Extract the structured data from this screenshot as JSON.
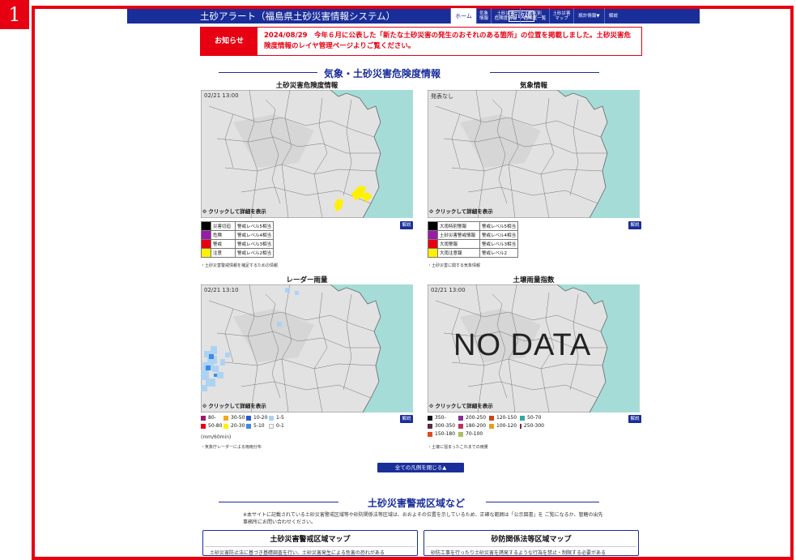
{
  "step_number": "1",
  "header": {
    "title": "土砂アラート（福島県土砂災害情報システム）",
    "badge": "行政版",
    "nav": [
      {
        "label": "ホーム",
        "active": true
      },
      {
        "label": "気象\n情報"
      },
      {
        "label": "土砂災害\n危険度情報"
      },
      {
        "label": "地区別\n危険度一覧"
      },
      {
        "label": "土砂災害\nマップ"
      },
      {
        "label": "統計情報▼"
      },
      {
        "label": "解説"
      }
    ]
  },
  "notice": {
    "label": "お知らせ",
    "text": "2024/08/29　今年６月に公表した「新たな土砂災害の発生のおそれのある箇所」の位置を掲載しました。土砂災害危険度情報のレイヤ管理ページよりご覧ください。"
  },
  "section1_title": "気象・土砂災害危険度情報",
  "panels": {
    "risk": {
      "title": "土砂災害危険度情報",
      "timestamp": "02/21 13:00",
      "hint": "クリックして詳細を表示",
      "help": "解説",
      "legend": [
        {
          "color": "#000000",
          "label": "災害切迫",
          "level": "警戒レベル5相当"
        },
        {
          "color": "#9b1ba8",
          "label": "危険",
          "level": "警戒レベル4相当"
        },
        {
          "color": "#e60012",
          "label": "警戒",
          "level": "警戒レベル3相当"
        },
        {
          "color": "#fff000",
          "label": "注意",
          "level": "警戒レベル2相当"
        }
      ],
      "note": "・土砂災害警戒情報を補足するための情報"
    },
    "weather": {
      "title": "気象情報",
      "timestamp": "発表なし",
      "hint": "クリックして詳細を表示",
      "help": "解説",
      "legend": [
        {
          "color": "#000000",
          "label": "大雨特別警報",
          "level": "警戒レベル5相当"
        },
        {
          "color": "#9b1ba8",
          "label": "土砂災害警戒情報",
          "level": "警戒レベル4相当"
        },
        {
          "color": "#e60012",
          "label": "大雨警報",
          "level": "警戒レベル3相当"
        },
        {
          "color": "#fff000",
          "label": "大雨注意報",
          "level": "警戒レベル2"
        }
      ],
      "note": "・土砂災害に関する気象情報"
    },
    "radar": {
      "title": "レーダー雨量",
      "timestamp": "02/21 13:10",
      "hint": "クリックして詳細を表示",
      "help": "解説",
      "legend": [
        {
          "color": "#a0196a",
          "label": "80-"
        },
        {
          "color": "#f5a623",
          "label": "30-50"
        },
        {
          "color": "#2b58d9",
          "label": "10-20"
        },
        {
          "color": "#a8d2f5",
          "label": "1-5"
        },
        {
          "color": "#e60012",
          "label": "50-80"
        },
        {
          "color": "#fff000",
          "label": "20-30"
        },
        {
          "color": "#3a8be8",
          "label": "5-10"
        },
        {
          "color": "#eef4fb",
          "label": "0-1"
        }
      ],
      "unit": "(mm/60min)",
      "note": "・気象庁レーダーによる雨雨分布"
    },
    "soil": {
      "title": "土壌雨量指数",
      "timestamp": "02/21 13:00",
      "nodata": "NO DATA",
      "hint": "クリックして詳細を表示",
      "help": "解説",
      "legend": [
        {
          "color": "#111111",
          "label": "350-"
        },
        {
          "color": "#8a2a9e",
          "label": "200-250"
        },
        {
          "color": "#d0421b",
          "label": "120-150"
        },
        {
          "color": "#2fa9a0",
          "label": "50-70"
        },
        {
          "color": "#5a2d46",
          "label": "300-350"
        },
        {
          "color": "#c03060",
          "label": "180-200"
        },
        {
          "color": "#e0a020",
          "label": "100-120"
        },
        {
          "color": "#7a2a3e",
          "label": "250-300"
        },
        {
          "color": "#e84a1a",
          "label": "150-180"
        },
        {
          "color": "#a8c060",
          "label": "70-100"
        }
      ],
      "note": "・土壌に溜まったこれまでの雨量"
    }
  },
  "close_legend_button": "全ての凡例を閉じる▲",
  "section2_title": "土砂災害警戒区域など",
  "disclaimer": "※本サイトに記載されている土砂災害警戒区域等や砂防関係法等区域は、おおよその位置を示しているため、正確な範囲は「公示図書」を ご覧になるか、管轄の出先事務所にお問い合わせください。",
  "boxes": [
    {
      "title": "土砂災害警戒区域マップ",
      "text": "土砂災害防止法に基づき基礎調査を行い、土砂災害発生による危害の恐れがある"
    },
    {
      "title": "砂防関係法等区域マップ",
      "text": "砂防工事を行ったり土砂災害を誘発するような行為を禁止・制限する必要がある"
    }
  ],
  "colors": {
    "accent": "#1a2e9a",
    "frame": "#e60012",
    "sea": "#a6dcd8",
    "land": "#e2e2e2"
  }
}
